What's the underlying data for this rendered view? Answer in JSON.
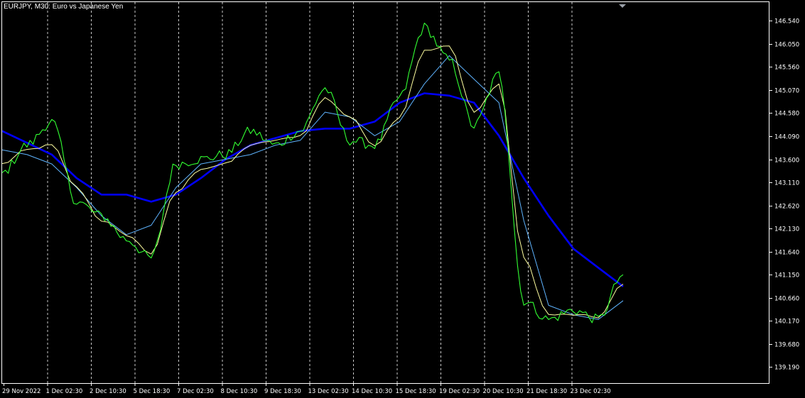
{
  "chart_title": "EURJPY, M30:  Euro vs Japanese Yen",
  "colors": {
    "background": "#000000",
    "foreground": "#ffffff",
    "grid": "#c8c8c8",
    "price": "#32ff32",
    "ma_fast": "#ffffa0",
    "ma_medium": "#5fb4ff",
    "ma_slow": "#0000ff"
  },
  "chart_data": {
    "type": "line",
    "title": "EURJPY, M30:  Euro vs Japanese Yen",
    "ylim": [
      138.85,
      146.95
    ],
    "y_ticks": [
      "146.540",
      "146.050",
      "145.560",
      "145.070",
      "144.580",
      "144.090",
      "143.600",
      "143.110",
      "142.620",
      "142.130",
      "141.640",
      "141.150",
      "140.660",
      "140.170",
      "139.680",
      "139.190"
    ],
    "categories": [
      "29 Nov 2022",
      "1 Dec 02:30",
      "2 Dec 10:30",
      "5 Dec 18:30",
      "7 Dec 02:30",
      "8 Dec 10:30",
      "9 Dec 18:30",
      "13 Dec 02:30",
      "14 Dec 10:30",
      "15 Dec 18:30",
      "19 Dec 02:30",
      "20 Dec 10:30",
      "21 Dec 18:30",
      "23 Dec 02:30"
    ],
    "x_labels": [
      "29 Nov 2022",
      "1 Dec 02:30",
      "2 Dec 10:30",
      "5 Dec 18:30",
      "7 Dec 02:30",
      "8 Dec 10:30",
      "9 Dec 18:30",
      "13 Dec 02:30",
      "14 Dec 10:30",
      "15 Dec 18:30",
      "19 Dec 02:30",
      "20 Dec 10:30",
      "21 Dec 18:30",
      "23 Dec 02:30"
    ],
    "grid": true,
    "series": [
      {
        "key": "price",
        "values": [
          143.3,
          143.9,
          144.4,
          142.7,
          142.4,
          141.9,
          141.5,
          143.5,
          143.6,
          143.7,
          144.2,
          143.9,
          144.2,
          145.1,
          144.0,
          143.9,
          144.9,
          146.4,
          145.7,
          144.3,
          145.4,
          140.6,
          140.2,
          140.4,
          140.2,
          141.15
        ]
      },
      {
        "key": "ma_fast",
        "values": [
          143.5,
          143.8,
          143.9,
          143.0,
          142.3,
          142.0,
          141.6,
          142.9,
          143.4,
          143.5,
          143.9,
          144.0,
          144.1,
          144.9,
          144.5,
          143.9,
          144.5,
          145.9,
          146.0,
          144.6,
          145.2,
          141.5,
          140.3,
          140.3,
          140.25,
          140.95
        ]
      },
      {
        "key": "ma_medium",
        "values": [
          143.8,
          143.7,
          143.5,
          143.0,
          142.4,
          142.0,
          142.2,
          143.0,
          143.5,
          143.6,
          143.7,
          143.9,
          144.0,
          144.6,
          144.5,
          144.1,
          144.4,
          145.2,
          145.8,
          145.3,
          144.8,
          142.3,
          140.5,
          140.3,
          140.2,
          140.6
        ]
      },
      {
        "key": "ma_slow",
        "values": [
          144.2,
          143.95,
          143.7,
          143.2,
          142.85,
          142.85,
          142.7,
          142.85,
          143.2,
          143.6,
          143.9,
          144.05,
          144.2,
          144.25,
          144.25,
          144.4,
          144.8,
          145.0,
          144.95,
          144.8,
          144.1,
          143.2,
          142.4,
          141.7,
          141.3,
          140.9
        ]
      }
    ]
  }
}
